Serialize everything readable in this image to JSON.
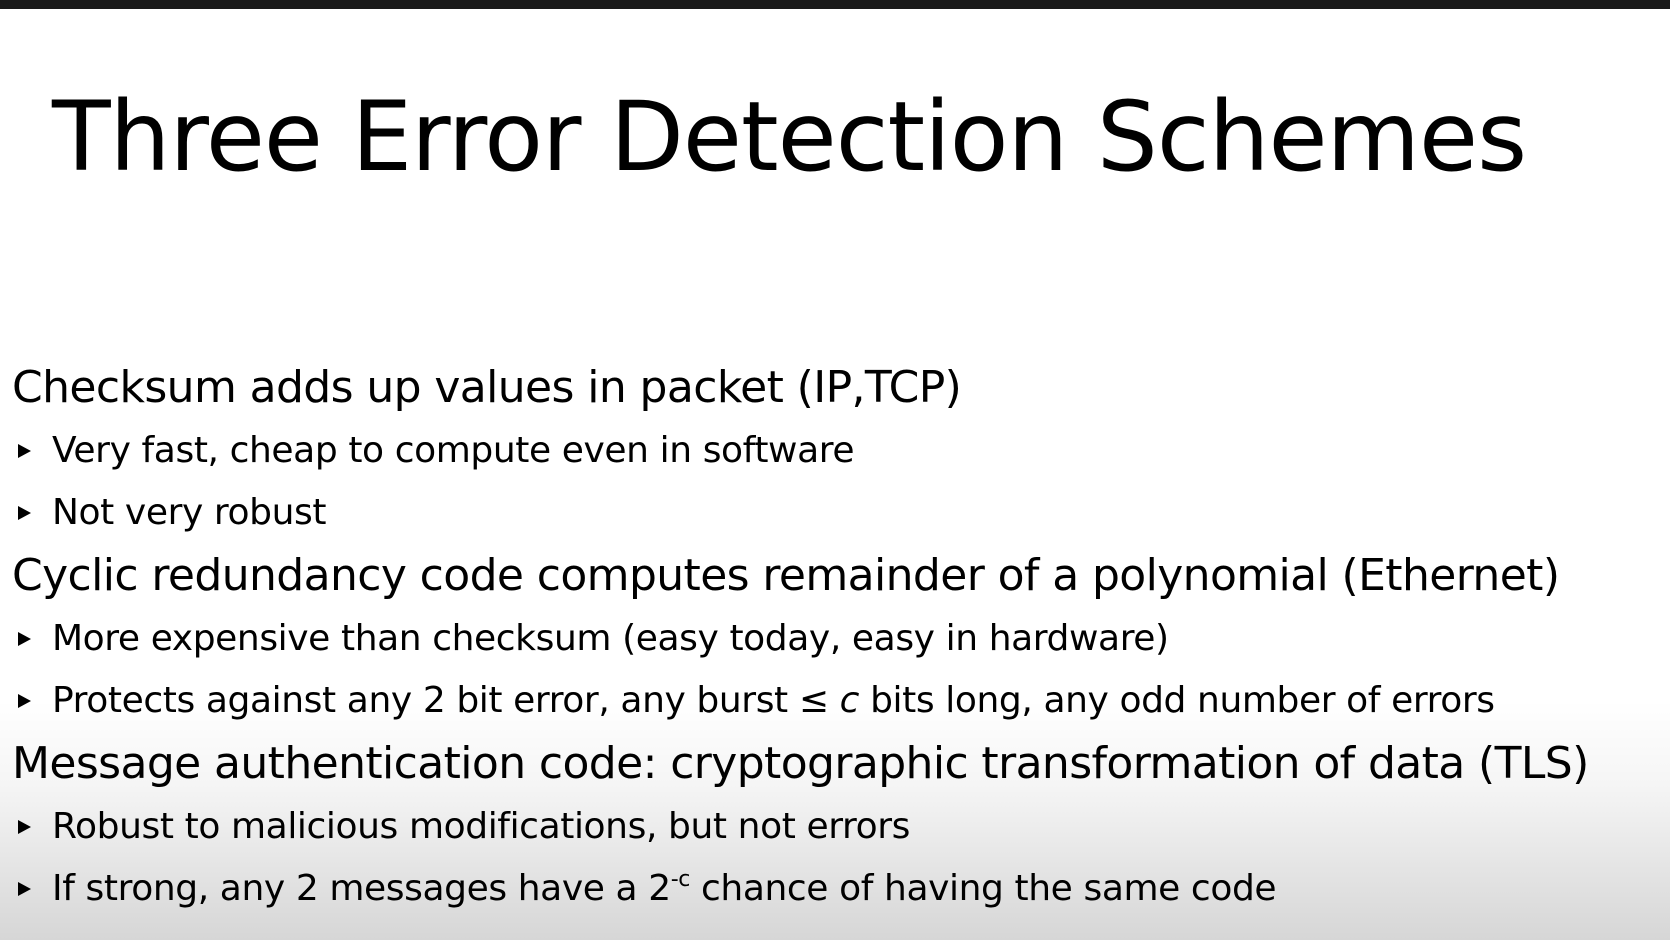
{
  "slide": {
    "title": "Three Error Detection Schemes",
    "schemes": [
      {
        "heading": "Checksum adds up values in packet (IP,TCP)",
        "bullets": [
          "Very fast, cheap to compute even in software",
          "Not very robust"
        ]
      },
      {
        "heading": "Cyclic redundancy code computes remainder of a polynomial (Ethernet)",
        "bullets": [
          "More expensive than checksum (easy today, easy in hardware)"
        ],
        "bullet_burst": {
          "before": "Protects against any 2 bit error, any burst ≤ ",
          "var": "c",
          "after": " bits long, any odd number of errors"
        }
      },
      {
        "heading": "Message authentication code: cryptographic transformation of data (TLS)",
        "bullets": [
          "Robust to malicious modifications, but not errors"
        ],
        "bullet_strong": {
          "before": "If strong, any 2 messages have a 2",
          "exponent": "-c",
          "after": " chance of having the same code"
        }
      }
    ]
  }
}
